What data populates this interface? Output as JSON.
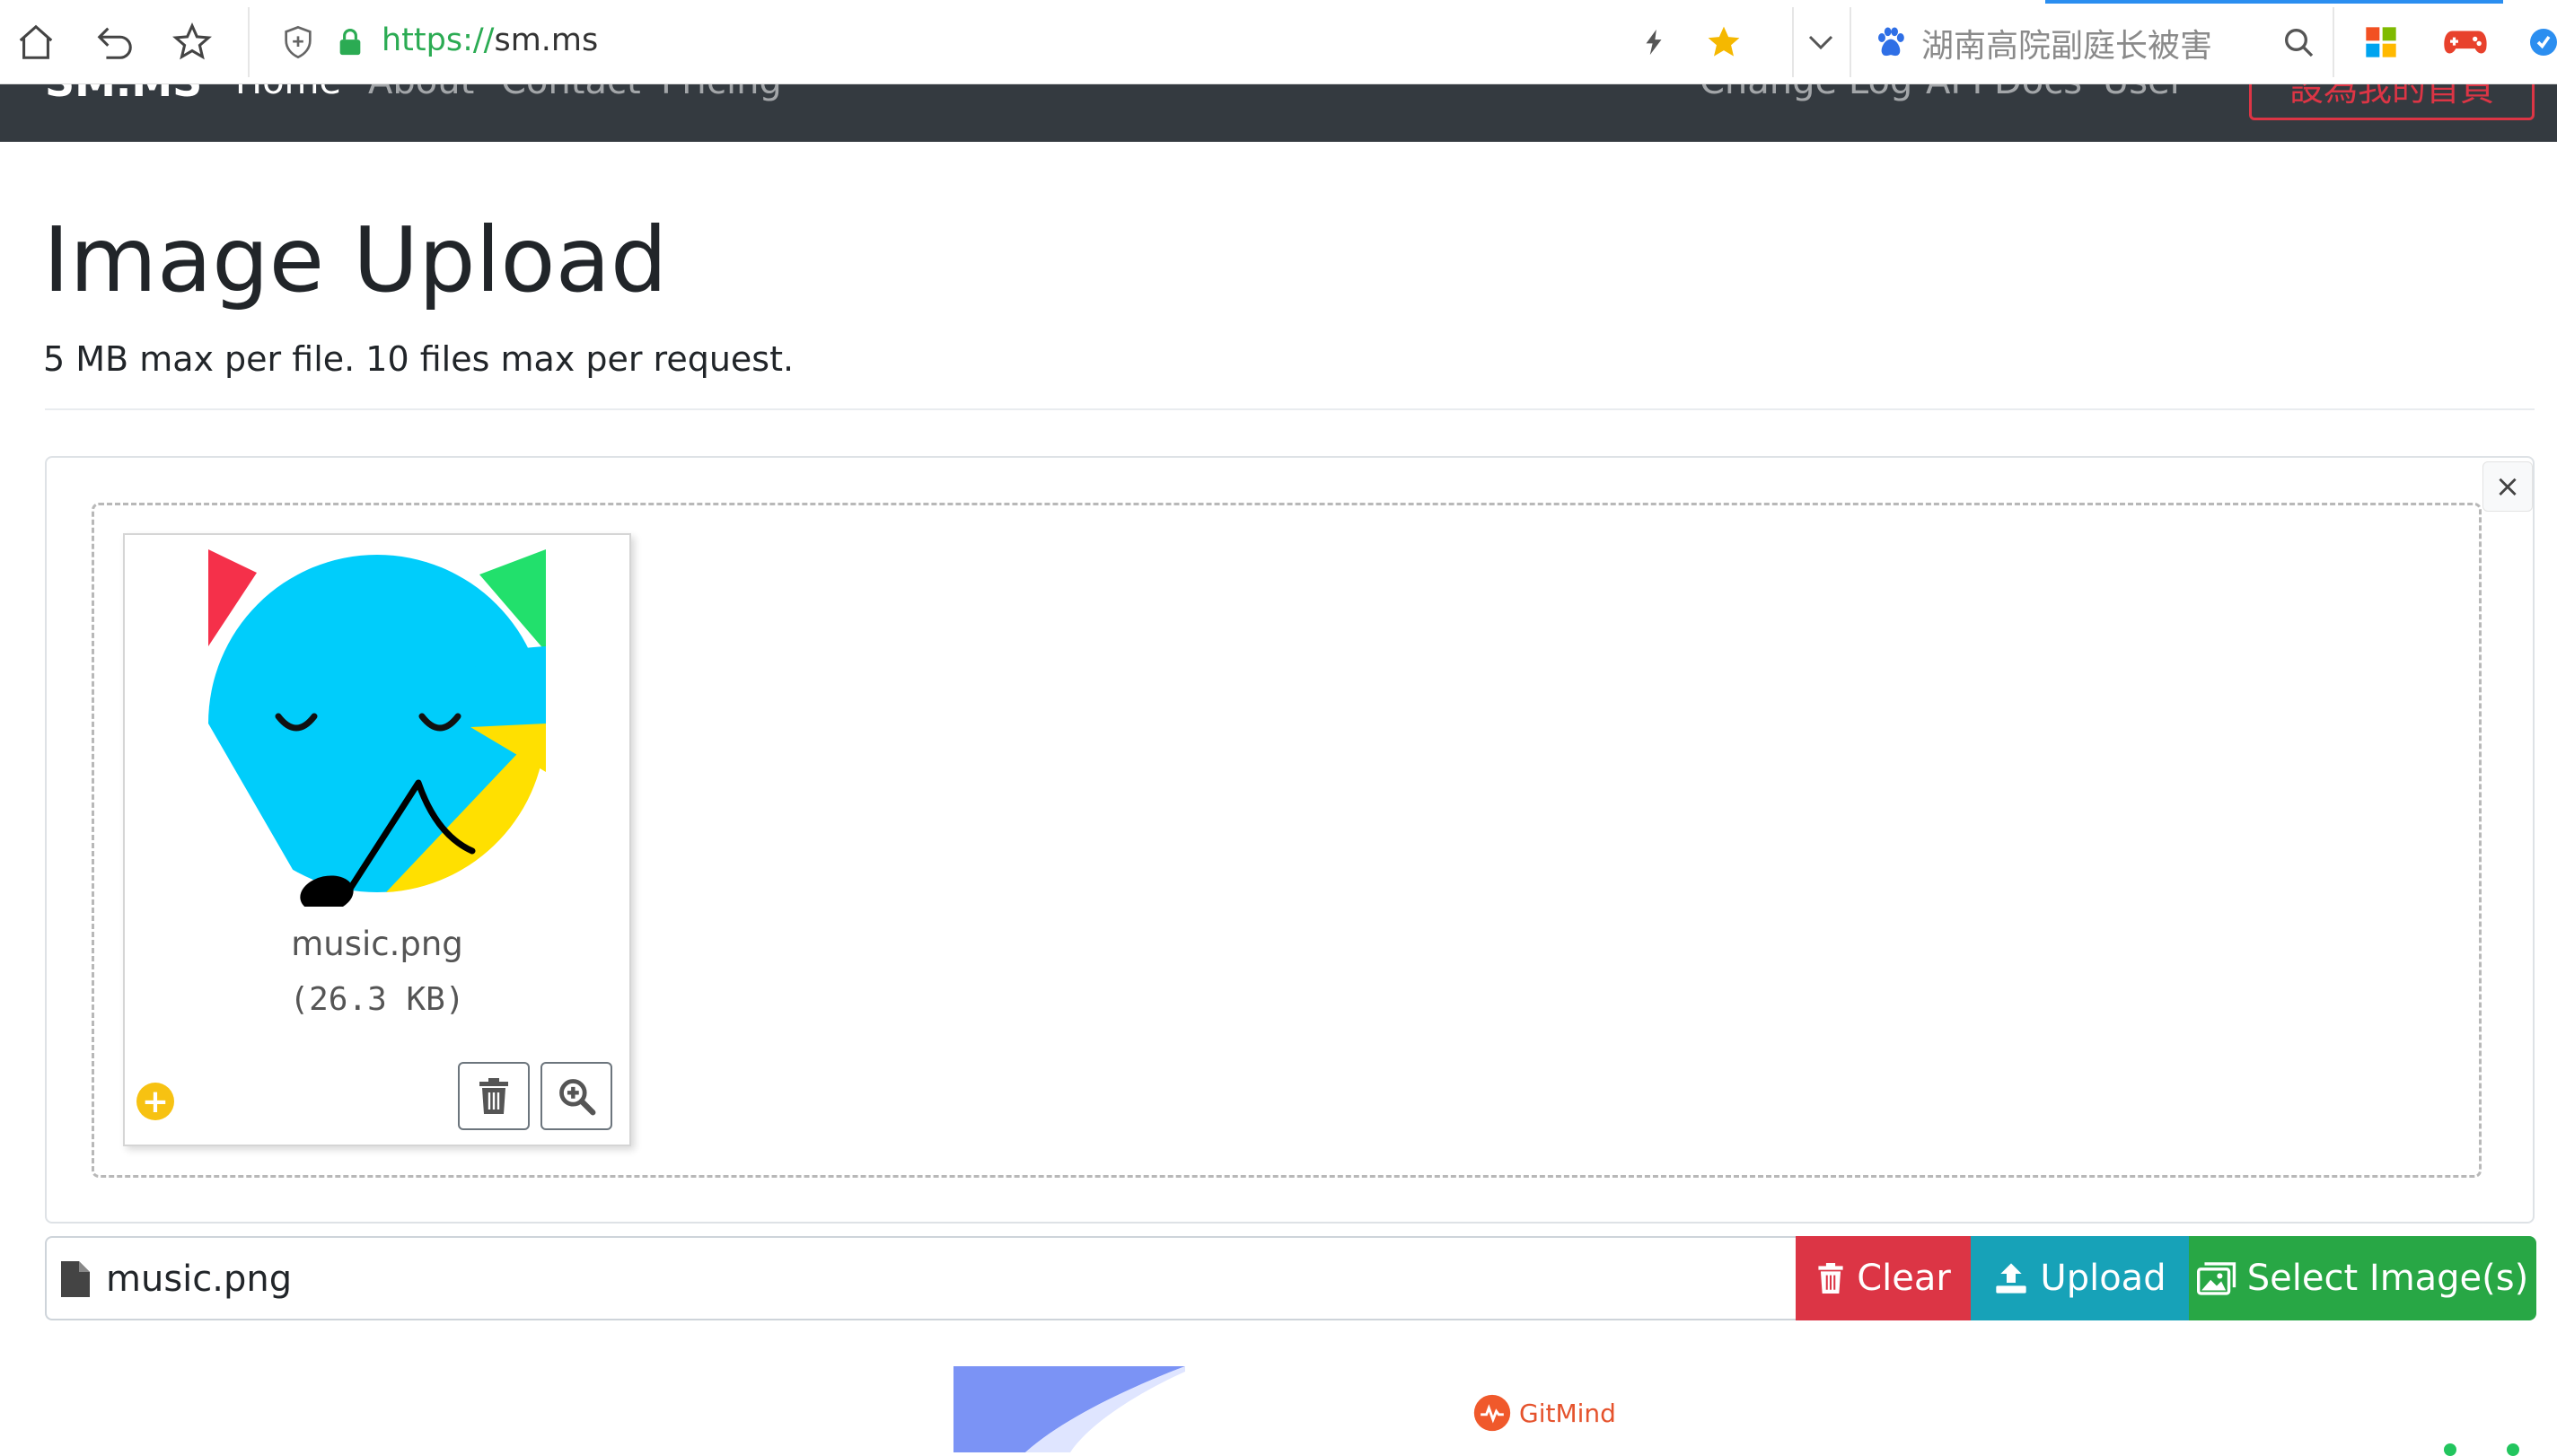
{
  "browser": {
    "url_scheme": "https://",
    "url_host": "sm.ms",
    "search_hint": "湖南高院副庭长被害",
    "accent_color": "#2b8ef0",
    "icons": [
      "home-icon",
      "back-icon",
      "bookmark-star-icon",
      "shield-icon",
      "lock-icon",
      "lightning-icon",
      "favorite-star-icon",
      "dropdown-chevron-icon",
      "baidu-paw-icon",
      "search-icon",
      "apps-grid-icon",
      "game-controller-icon"
    ]
  },
  "nav": {
    "brand": "SM.MS",
    "links": [
      "Home",
      "About",
      "Contact",
      "Pricing"
    ],
    "right_links": [
      "Change Log",
      "API Docs",
      "User"
    ],
    "cta": "設為我的首頁",
    "background": "#343a40"
  },
  "page": {
    "title": "Image Upload",
    "subtitle": "5 MB max per file. 10 files max per request."
  },
  "preview": {
    "close_label": "×",
    "file": {
      "name": "music.png",
      "size": "(26.3 KB)"
    }
  },
  "file_input": {
    "caption": "music.png"
  },
  "actions": {
    "clear": "Clear",
    "upload": "Upload",
    "select": "Select Image(s)",
    "colors": {
      "clear": "#dc3545",
      "upload": "#17a2b8",
      "select": "#28a745"
    }
  },
  "footer": {
    "ad_label": "GitMind"
  }
}
